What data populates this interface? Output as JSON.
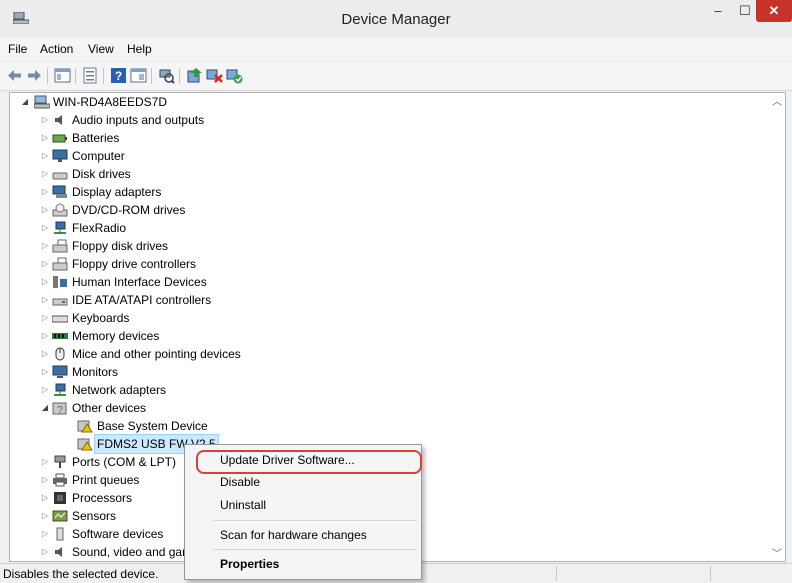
{
  "window": {
    "title": "Device Manager",
    "min_glyph": "–",
    "max_glyph": "☐",
    "close_glyph": "✕"
  },
  "menu": {
    "file": "File",
    "action": "Action",
    "view": "View",
    "help": "Help"
  },
  "tree": {
    "root": "WIN-RD4A8EEDS7D",
    "categories": [
      "Audio inputs and outputs",
      "Batteries",
      "Computer",
      "Disk drives",
      "Display adapters",
      "DVD/CD-ROM drives",
      "FlexRadio",
      "Floppy disk drives",
      "Floppy drive controllers",
      "Human Interface Devices",
      "IDE ATA/ATAPI controllers",
      "Keyboards",
      "Memory devices",
      "Mice and other pointing devices",
      "Monitors",
      "Network adapters",
      "Other devices",
      "Ports (COM & LPT)",
      "Print queues",
      "Processors",
      "Sensors",
      "Software devices",
      "Sound, video and game controllers"
    ],
    "other_devices_children": [
      "Base System Device",
      "FDMS2 USB FW V2.5"
    ]
  },
  "context_menu": {
    "update": "Update Driver Software...",
    "disable": "Disable",
    "uninstall": "Uninstall",
    "scan": "Scan for hardware changes",
    "properties": "Properties"
  },
  "status": {
    "text": "Disables the selected device."
  },
  "colors": {
    "close_button": "#c7322b",
    "selection": "#cce8ff",
    "highlight_ring": "#d9403a"
  }
}
